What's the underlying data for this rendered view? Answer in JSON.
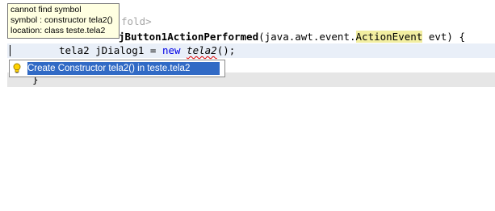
{
  "tooltip": {
    "line1": "cannot find symbol",
    "line2": "symbol : constructor tela2()",
    "line3": "location: class teste.tela2"
  },
  "editor": {
    "fold_text": "fold>",
    "method_tail": "jButton1ActionPerformed",
    "method_params_open": "(java.awt.event.",
    "action_event": "ActionEvent",
    "method_params_close": " evt) {",
    "stmt_type": "tela2 jDialog1 = ",
    "stmt_new": "new",
    "stmt_space": " ",
    "stmt_ctor": "tela2",
    "stmt_end": "();",
    "closing_brace": "}"
  },
  "popup": {
    "item_label": "Create Constructor tela2() in teste.tela2",
    "item_icon": "lightbulb-icon"
  }
}
